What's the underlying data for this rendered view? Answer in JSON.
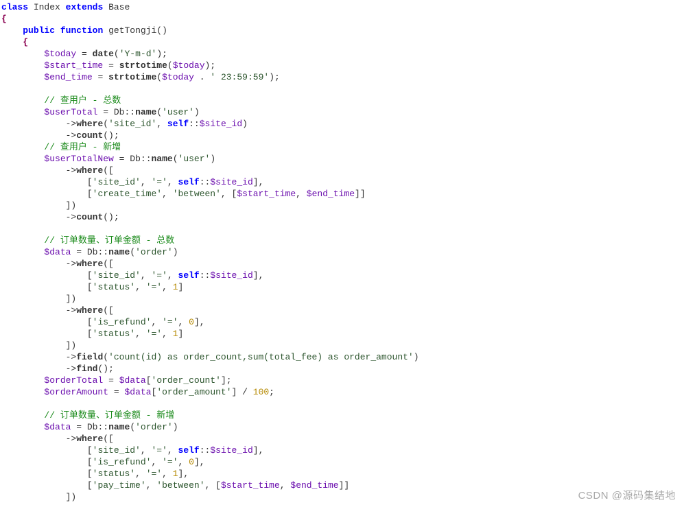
{
  "watermark": "CSDN @源码集结地",
  "code": {
    "l1": {
      "kw1": "class",
      "name": "Index",
      "kw2": "extends",
      "base": "Base"
    },
    "l2": {
      "brace": "{"
    },
    "l3": {
      "pub": "public",
      "fun": "function",
      "name": "getTongji",
      "paren": "()"
    },
    "l4": {
      "brace": "{"
    },
    "l5": {
      "var": "$today",
      "eq": "=",
      "fn": "date",
      "str": "'Y-m-d'",
      "end": ";"
    },
    "l6": {
      "var": "$start_time",
      "eq": "=",
      "fn": "strtotime",
      "arg": "$today",
      "end": ";"
    },
    "l7": {
      "var": "$end_time",
      "eq": "=",
      "fn": "strtotime",
      "arg": "$today",
      "cat": ".",
      "str": "' 23:59:59'",
      "end": ";"
    },
    "c1": "// 查用户 - 总数",
    "l8": {
      "var": "$userTotal",
      "eq": "=",
      "cls": "Db",
      "dc": "::",
      "fn": "name",
      "str": "'user'"
    },
    "l9": {
      "arrow": "->",
      "fn": "where",
      "str1": "'site_id'",
      "comma": ",",
      "self": "self",
      "dc": "::",
      "prop": "$site_id"
    },
    "l10": {
      "arrow": "->",
      "fn": "count",
      "paren": "()",
      "end": ";"
    },
    "c2": "// 查用户 - 新增",
    "l11": {
      "var": "$userTotalNew",
      "eq": "=",
      "cls": "Db",
      "dc": "::",
      "fn": "name",
      "str": "'user'"
    },
    "l12": {
      "arrow": "->",
      "fn": "where",
      "open": "(["
    },
    "l13": {
      "open": "[",
      "s1": "'site_id'",
      "c": ",",
      "s2": "'='",
      "c2": ",",
      "self": "self",
      "dc": "::",
      "prop": "$site_id",
      "close": "],"
    },
    "l14": {
      "open": "[",
      "s1": "'create_time'",
      "c": ",",
      "s2": "'between'",
      "c2": ",",
      "open2": "[",
      "v1": "$start_time",
      "c3": ",",
      "v2": "$end_time",
      "close2": "]]"
    },
    "l15": {
      "close": "])"
    },
    "l16": {
      "arrow": "->",
      "fn": "count",
      "paren": "()",
      "end": ";"
    },
    "c3": "// 订单数量、订单金额 - 总数",
    "l17": {
      "var": "$data",
      "eq": "=",
      "cls": "Db",
      "dc": "::",
      "fn": "name",
      "str": "'order'"
    },
    "l18": {
      "arrow": "->",
      "fn": "where",
      "open": "(["
    },
    "l19": {
      "open": "[",
      "s1": "'site_id'",
      "c": ",",
      "s2": "'='",
      "c2": ",",
      "self": "self",
      "dc": "::",
      "prop": "$site_id",
      "close": "],"
    },
    "l20": {
      "open": "[",
      "s1": "'status'",
      "c": ",",
      "s2": "'='",
      "c2": ",",
      "num": "1",
      "close": "]"
    },
    "l21": {
      "close": "])"
    },
    "l22": {
      "arrow": "->",
      "fn": "where",
      "open": "(["
    },
    "l23": {
      "open": "[",
      "s1": "'is_refund'",
      "c": ",",
      "s2": "'='",
      "c2": ",",
      "num": "0",
      "close": "],"
    },
    "l24": {
      "open": "[",
      "s1": "'status'",
      "c": ",",
      "s2": "'='",
      "c2": ",",
      "num": "1",
      "close": "]"
    },
    "l25": {
      "close": "])"
    },
    "l26": {
      "arrow": "->",
      "fn": "field",
      "str": "'count(id) as order_count,sum(total_fee) as order_amount'"
    },
    "l27": {
      "arrow": "->",
      "fn": "find",
      "paren": "()",
      "end": ";"
    },
    "l28": {
      "var": "$orderTotal",
      "eq": "=",
      "arg": "$data",
      "idx": "'order_count'",
      "end": ";"
    },
    "l29": {
      "var": "$orderAmount",
      "eq": "=",
      "arg": "$data",
      "idx": "'order_amount'",
      "div": "/",
      "num": "100",
      "end": ";"
    },
    "c4": "// 订单数量、订单金额 - 新增",
    "l30": {
      "var": "$data",
      "eq": "=",
      "cls": "Db",
      "dc": "::",
      "fn": "name",
      "str": "'order'"
    },
    "l31": {
      "arrow": "->",
      "fn": "where",
      "open": "(["
    },
    "l32": {
      "open": "[",
      "s1": "'site_id'",
      "c": ",",
      "s2": "'='",
      "c2": ",",
      "self": "self",
      "dc": "::",
      "prop": "$site_id",
      "close": "],"
    },
    "l33": {
      "open": "[",
      "s1": "'is_refund'",
      "c": ",",
      "s2": "'='",
      "c2": ",",
      "num": "0",
      "close": "],"
    },
    "l34": {
      "open": "[",
      "s1": "'status'",
      "c": ",",
      "s2": "'='",
      "c2": ",",
      "num": "1",
      "close": "],"
    },
    "l35": {
      "open": "[",
      "s1": "'pay_time'",
      "c": ",",
      "s2": "'between'",
      "c2": ",",
      "open2": "[",
      "v1": "$start_time",
      "c3": ",",
      "v2": "$end_time",
      "close2": "]]"
    },
    "l36": {
      "close": "])"
    }
  }
}
